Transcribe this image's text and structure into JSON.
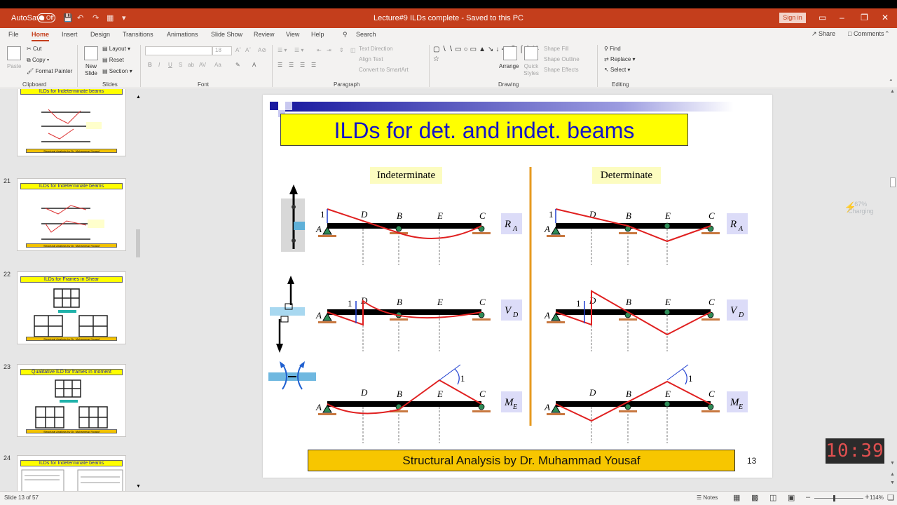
{
  "titlebar": {
    "autosave_label": "AutoSave",
    "autosave_state": "Off",
    "document_title": "Lecture#9 ILDs complete  -  Saved to this PC",
    "signin_label": "Sign in"
  },
  "tabs": [
    "File",
    "Home",
    "Insert",
    "Design",
    "Transitions",
    "Animations",
    "Slide Show",
    "Review",
    "View",
    "Help"
  ],
  "search_label": "Search",
  "share_label": "Share",
  "comments_label": "Comments",
  "ribbon": {
    "clipboard": {
      "paste": "Paste",
      "cut": "Cut",
      "copy": "Copy",
      "format_painter": "Format Painter",
      "group": "Clipboard"
    },
    "slides": {
      "new_slide": "New Slide",
      "layout": "Layout",
      "reset": "Reset",
      "section": "Section",
      "group": "Slides"
    },
    "font": {
      "size": "18",
      "group": "Font"
    },
    "paragraph": {
      "text_direction": "Text Direction",
      "align_text": "Align Text",
      "convert_smartart": "Convert to SmartArt",
      "group": "Paragraph"
    },
    "drawing": {
      "arrange": "Arrange",
      "quick_styles": "Quick Styles",
      "shape_fill": "Shape Fill",
      "shape_outline": "Shape Outline",
      "shape_effects": "Shape Effects",
      "group": "Drawing"
    },
    "editing": {
      "find": "Find",
      "replace": "Replace",
      "select": "Select",
      "group": "Editing"
    }
  },
  "thumbnails": [
    {
      "num": "",
      "title": "ILDs for Indeterminate beams",
      "footer": "Structural Analysis by Dr. Muhammad Yousaf"
    },
    {
      "num": "21",
      "title": "ILDs for Indeterminate beams",
      "footer": "Structural Analysis by Dr. Muhammad Yousaf"
    },
    {
      "num": "22",
      "title": "ILDs for Frames in Shear",
      "footer": "Structural Analysis by Dr. Muhammad Yousaf"
    },
    {
      "num": "23",
      "title": "Qualitative ILD  for frames in moment",
      "footer": "Structural Analysis by Dr. Muhammad Yousaf"
    },
    {
      "num": "24",
      "title": "ILDs for Indeterminate beams",
      "footer": ""
    }
  ],
  "slide": {
    "title": "ILDs for det. and indet. beams",
    "left_heading": "Indeterminate",
    "right_heading": "Determinate",
    "footer": "Structural Analysis by Dr. Muhammad Yousaf",
    "number": "13",
    "rows": [
      {
        "quantity": "R",
        "sub": "A"
      },
      {
        "quantity": "V",
        "sub": "D"
      },
      {
        "quantity": "M",
        "sub": "E"
      }
    ],
    "points": {
      "a": "A",
      "d": "D",
      "b": "B",
      "e": "E",
      "c": "C",
      "unit": "1"
    }
  },
  "overlay": {
    "battery_percent": "67%",
    "battery_state": "Charging",
    "clock": "10:39"
  },
  "status": {
    "slide_info": "Slide 13 of 57",
    "notes": "Notes",
    "zoom": "114%"
  },
  "colors": {
    "accent": "#c43e1c",
    "ild_line": "#e02020",
    "beam": "#000000",
    "support": "#2e8b57"
  }
}
